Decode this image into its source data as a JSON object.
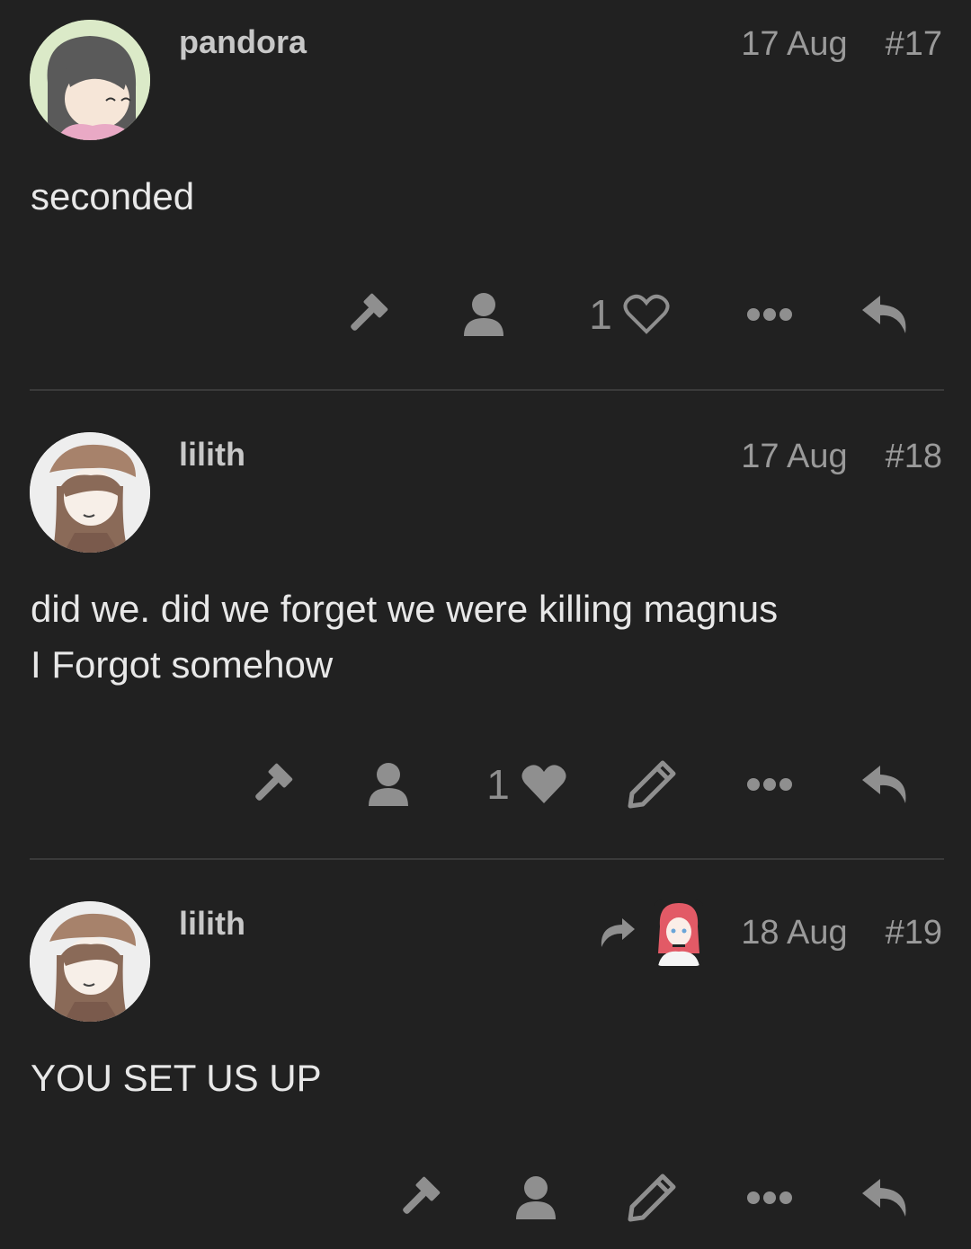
{
  "posts": [
    {
      "username": "pandora",
      "date": "17 Aug",
      "number": "#17",
      "lines": [
        "seconded"
      ],
      "like_count": "1",
      "liked": false
    },
    {
      "username": "lilith",
      "date": "17 Aug",
      "number": "#18",
      "lines": [
        "did we. did we forget we were killing magnus",
        "I Forgot somehow"
      ],
      "like_count": "1",
      "liked": true
    },
    {
      "username": "lilith",
      "date": "18 Aug",
      "number": "#19",
      "lines": [
        "YOU SET US UP"
      ]
    }
  ],
  "icons": {
    "flag": "gavel-icon",
    "user": "user-icon",
    "like": "heart-icon",
    "edit": "pencil-icon",
    "more": "ellipsis-icon",
    "reply": "reply-icon",
    "reply_to": "share-arrow-icon"
  },
  "colors": {
    "background": "#212121",
    "text": "#e8e8e8",
    "muted": "#8f8f8f",
    "divider": "#3a3a3a"
  }
}
